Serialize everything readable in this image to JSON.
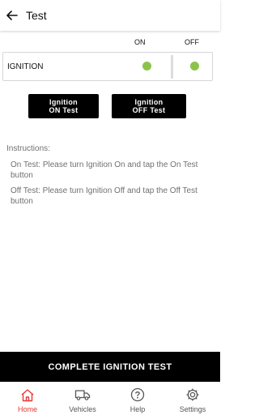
{
  "header": {
    "title": "Test",
    "back_icon": "arrow-left-icon"
  },
  "columns": {
    "on": "ON",
    "off": "OFF"
  },
  "ignition_row": {
    "label": "IGNITION",
    "on_status_color": "#8bc34a",
    "off_status_color": "#8bc34a"
  },
  "buttons": {
    "on_test": {
      "line1": "Ignition",
      "line2": "ON Test"
    },
    "off_test": {
      "line1": "Ignition",
      "line2": "OFF Test"
    }
  },
  "instructions": {
    "heading": "Instructions:",
    "on_test": "On Test: Please turn Ignition On and tap the On Test button",
    "off_test": "Off Test: Please turn Ignition Off and tap the Off Test button"
  },
  "complete_button": {
    "label": "COMPLETE IGNITION TEST"
  },
  "bottom_nav": {
    "active_color": "#e53935",
    "items": [
      {
        "label": "Home",
        "icon": "home-icon",
        "active": true
      },
      {
        "label": "Vehicles",
        "icon": "truck-icon",
        "active": false
      },
      {
        "label": "Help",
        "icon": "help-icon",
        "active": false
      },
      {
        "label": "Settings",
        "icon": "gear-icon",
        "active": false
      }
    ]
  }
}
